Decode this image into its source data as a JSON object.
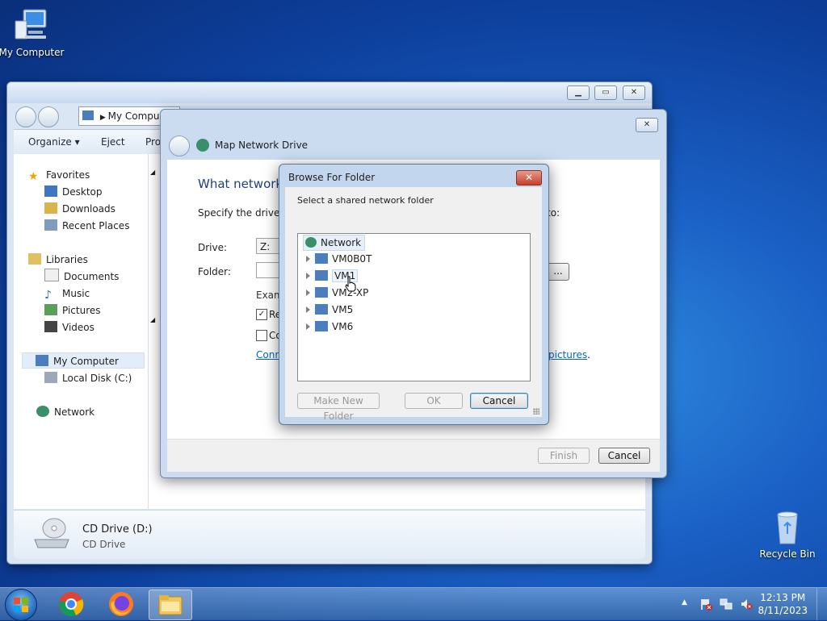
{
  "desktop": {
    "my_computer_label": "My Computer",
    "recycle_bin_label": "Recycle Bin"
  },
  "explorer": {
    "address": "My Compute",
    "toolbar": {
      "organize": "Organize ▾",
      "eject": "Eject",
      "properties": "Pro"
    },
    "nav": {
      "favorites": "Favorites",
      "desktop": "Desktop",
      "downloads": "Downloads",
      "recent_places": "Recent Places",
      "libraries": "Libraries",
      "documents": "Documents",
      "music": "Music",
      "pictures": "Pictures",
      "videos": "Videos",
      "my_computer": "My Computer",
      "local_disk": "Local Disk (C:)",
      "network": "Network"
    },
    "details": {
      "name": "CD Drive (D:)",
      "type": "CD Drive"
    }
  },
  "map_drive": {
    "title": "Map Network Drive",
    "heading": "What network",
    "specify": "Specify the drive let",
    "specify_tail": "to:",
    "drive_label": "Drive:",
    "drive_value": "Z:",
    "folder_label": "Folder:",
    "browse_label": "...",
    "example": "Exam",
    "reconnect_label": "Re",
    "reconnect_checked": true,
    "connect_creds_label": "Co",
    "link_text": "Conn",
    "link_tail": "pictures",
    "link_period": ".",
    "finish": "Finish",
    "cancel": "Cancel"
  },
  "browse": {
    "title": "Browse For Folder",
    "close": "✕",
    "instruction": "Select a shared network folder",
    "tree": {
      "root": "Network",
      "items": [
        "VM0B0T",
        "VM1",
        "VM2-XP",
        "VM5",
        "VM6"
      ]
    },
    "make_new_folder": "Make New Folder",
    "ok": "OK",
    "cancel": "Cancel"
  },
  "taskbar": {
    "time": "12:13 PM",
    "date": "8/11/2023",
    "show_hidden": "▲"
  },
  "colors": {
    "accent": "#3c7fb1",
    "link": "#0066cc",
    "close_red": "#c6402a"
  }
}
